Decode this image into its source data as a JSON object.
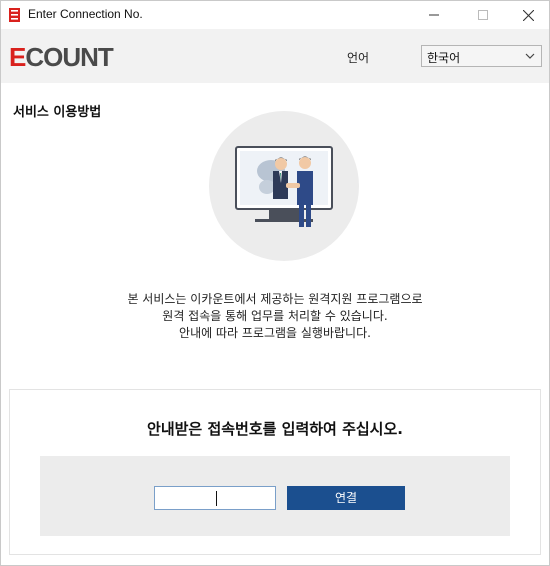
{
  "window": {
    "title": "Enter Connection No.",
    "controls": {
      "minimize": "minimize-icon",
      "maximize": "maximize-icon",
      "close": "close-icon"
    }
  },
  "header": {
    "logo_first": "E",
    "logo_rest": "COUNT",
    "language_label": "언어",
    "language_selected": "한국어"
  },
  "section": {
    "title": "서비스 이용방법",
    "description": [
      "본 서비스는 이카운트에서 제공하는 원격지원 프로그램으로",
      "원격 접속을 통해 업무를 처리할 수 있습니다.",
      "안내에 따라 프로그램을 실행바랍니다."
    ]
  },
  "connect": {
    "prompt": "안내받은 접속번호를 입력하여 주십시오.",
    "input_value": "",
    "button_label": "연결"
  },
  "colors": {
    "brand_red": "#d9211d",
    "button_blue": "#1b4f8f",
    "header_bg": "#f2f2f2"
  }
}
